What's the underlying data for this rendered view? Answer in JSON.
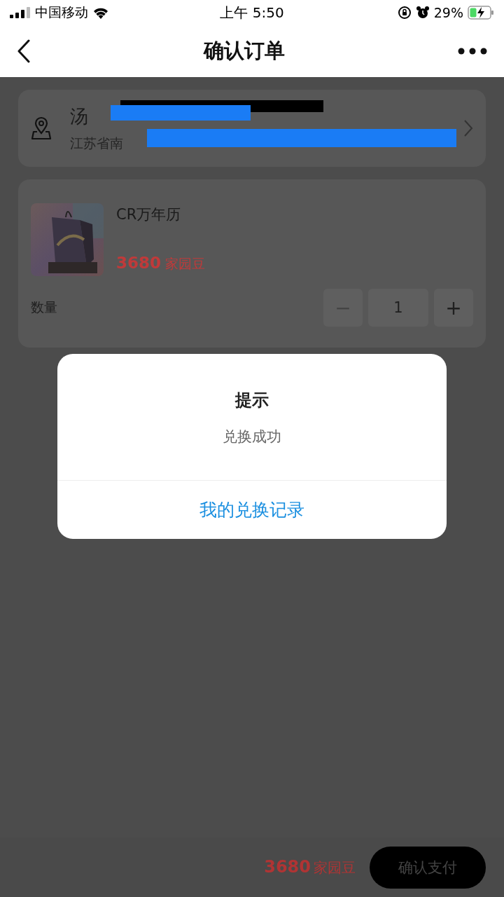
{
  "status_bar": {
    "carrier": "中国移动",
    "time": "上午 5:50",
    "battery": "29%"
  },
  "nav": {
    "title": "确认订单"
  },
  "address": {
    "name": "汤",
    "detail": "江苏省南"
  },
  "product": {
    "name": "CR万年历",
    "price": "3680",
    "unit": "家园豆"
  },
  "quantity": {
    "label": "数量",
    "minus": "−",
    "value": "1",
    "plus": "+"
  },
  "footer": {
    "total": "3680",
    "unit": "家园豆",
    "button": "确认支付"
  },
  "dialog": {
    "title": "提示",
    "message": "兑换成功",
    "action": "我的兑换记录"
  }
}
